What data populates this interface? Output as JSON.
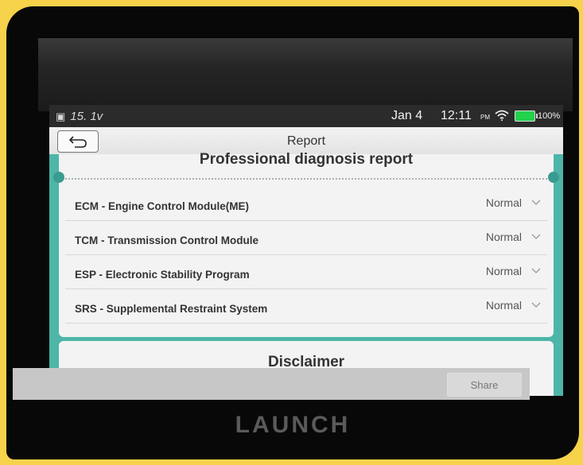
{
  "status_bar": {
    "left_text": "15. 1v",
    "date": "Jan 4",
    "time": "12:11",
    "ampm": "PM",
    "battery": "100%",
    "icons": [
      "gallery-icon",
      "wifi-icon",
      "battery-icon"
    ]
  },
  "titlebar": {
    "title": "Report",
    "back_icon": "back-arrow-icon"
  },
  "report": {
    "heading": "Professional diagnosis report",
    "modules": [
      {
        "name": "ECM - Engine Control Module(ME)",
        "status": "Normal"
      },
      {
        "name": "TCM - Transmission Control Module",
        "status": "Normal"
      },
      {
        "name": "ESP - Electronic Stability Program",
        "status": "Normal"
      },
      {
        "name": "SRS - Supplemental Restraint System",
        "status": "Normal"
      }
    ]
  },
  "disclaimer": {
    "title": "Disclaimer"
  },
  "bottom_bar": {
    "share_label": "Share"
  },
  "device": {
    "brand": "LAUNCH"
  },
  "colors": {
    "accent": "#4db6a8",
    "battery": "#22d24b",
    "frame": "#f7d34b"
  }
}
